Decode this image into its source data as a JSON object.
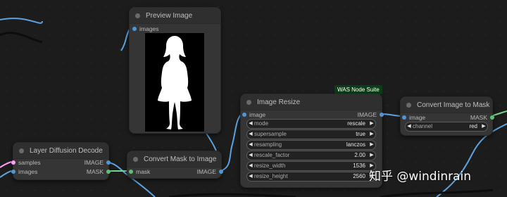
{
  "colors": {
    "image_pin": "#4d97d6",
    "mask_pin": "#5cc176",
    "latent_pin": "#ff9cf9",
    "wire_image": "#5da2e0",
    "wire_mask": "#7ad191",
    "badge_bg": "#0b3d16"
  },
  "preview_node": {
    "title": "Preview Image",
    "input_images": "images"
  },
  "layer_diffusion_node": {
    "title": "Layer Diffusion Decode",
    "input_samples": "samples",
    "input_images": "images",
    "output_image": "IMAGE",
    "output_mask": "MASK"
  },
  "convert_mask_node": {
    "title": "Convert Mask to Image",
    "input_mask": "mask",
    "output_image": "IMAGE"
  },
  "image_resize_node": {
    "badge": "WAS Node Suite",
    "title": "Image Resize",
    "input_image": "image",
    "output_image": "IMAGE",
    "widgets": [
      {
        "label": "mode",
        "value": "rescale"
      },
      {
        "label": "supersample",
        "value": "true"
      },
      {
        "label": "resampling",
        "value": "lanczos"
      },
      {
        "label": "rescale_factor",
        "value": "2.00"
      },
      {
        "label": "resize_width",
        "value": "1536"
      },
      {
        "label": "resize_height",
        "value": "2560"
      }
    ]
  },
  "convert_image_mask_node": {
    "title": "Convert Image to Mask",
    "input_image": "image",
    "output_mask": "MASK",
    "widget_channel_label": "channel",
    "widget_channel_value": "red"
  },
  "watermark": "知乎 @windinrain",
  "icons": {
    "collapse_dot": "node-collapse-dot-icon",
    "arrow_left": "◀",
    "arrow_right": "▶"
  }
}
